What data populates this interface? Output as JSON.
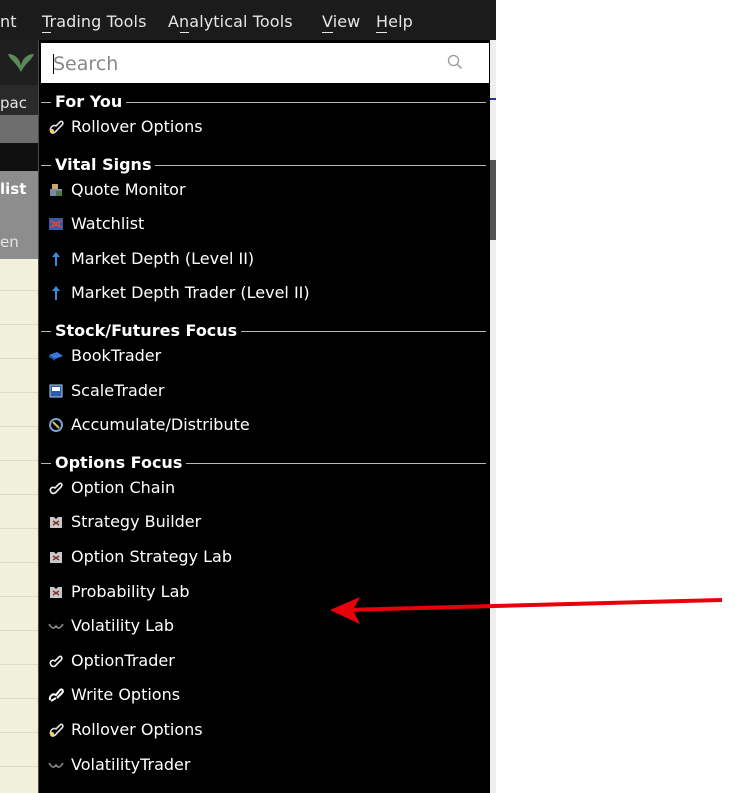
{
  "menubar": {
    "items": [
      {
        "label": "nt"
      },
      {
        "label": "Trading Tools"
      },
      {
        "label": "Analytical Tools"
      },
      {
        "label": "View"
      },
      {
        "label": "Help"
      }
    ]
  },
  "background": {
    "left_labels": [
      "pac",
      "list",
      "en"
    ]
  },
  "search": {
    "placeholder": "Search",
    "value": ""
  },
  "sections": [
    {
      "label": "For You",
      "items": [
        {
          "label": "Rollover Options",
          "icon": "rollover-icon"
        }
      ]
    },
    {
      "label": "Vital Signs",
      "items": [
        {
          "label": "Quote Monitor",
          "icon": "quote-monitor-icon"
        },
        {
          "label": "Watchlist",
          "icon": "watchlist-icon"
        },
        {
          "label": "Market Depth (Level II)",
          "icon": "market-depth-icon"
        },
        {
          "label": "Market Depth Trader (Level II)",
          "icon": "market-depth-icon"
        }
      ]
    },
    {
      "label": "Stock/Futures Focus",
      "items": [
        {
          "label": "BookTrader",
          "icon": "booktrader-icon"
        },
        {
          "label": "ScaleTrader",
          "icon": "scaletrader-icon"
        },
        {
          "label": "Accumulate/Distribute",
          "icon": "accumulate-icon"
        }
      ]
    },
    {
      "label": "Options Focus",
      "items": [
        {
          "label": "Option Chain",
          "icon": "option-chain-icon"
        },
        {
          "label": "Strategy Builder",
          "icon": "strategy-icon"
        },
        {
          "label": "Option Strategy Lab",
          "icon": "strategy-icon"
        },
        {
          "label": "Probability Lab",
          "icon": "strategy-icon"
        },
        {
          "label": "Volatility Lab",
          "icon": "volatility-icon"
        },
        {
          "label": "OptionTrader",
          "icon": "option-chain-icon"
        },
        {
          "label": "Write Options",
          "icon": "write-options-icon"
        },
        {
          "label": "Rollover Options",
          "icon": "rollover-icon"
        },
        {
          "label": "VolatilityTrader",
          "icon": "volatility-icon"
        }
      ]
    }
  ],
  "colors": {
    "menubar_bg": "#1b1b1b",
    "dropdown_bg": "#000000",
    "annotation_arrow": "#e8000b",
    "background_rows": "#f0f0dc"
  }
}
